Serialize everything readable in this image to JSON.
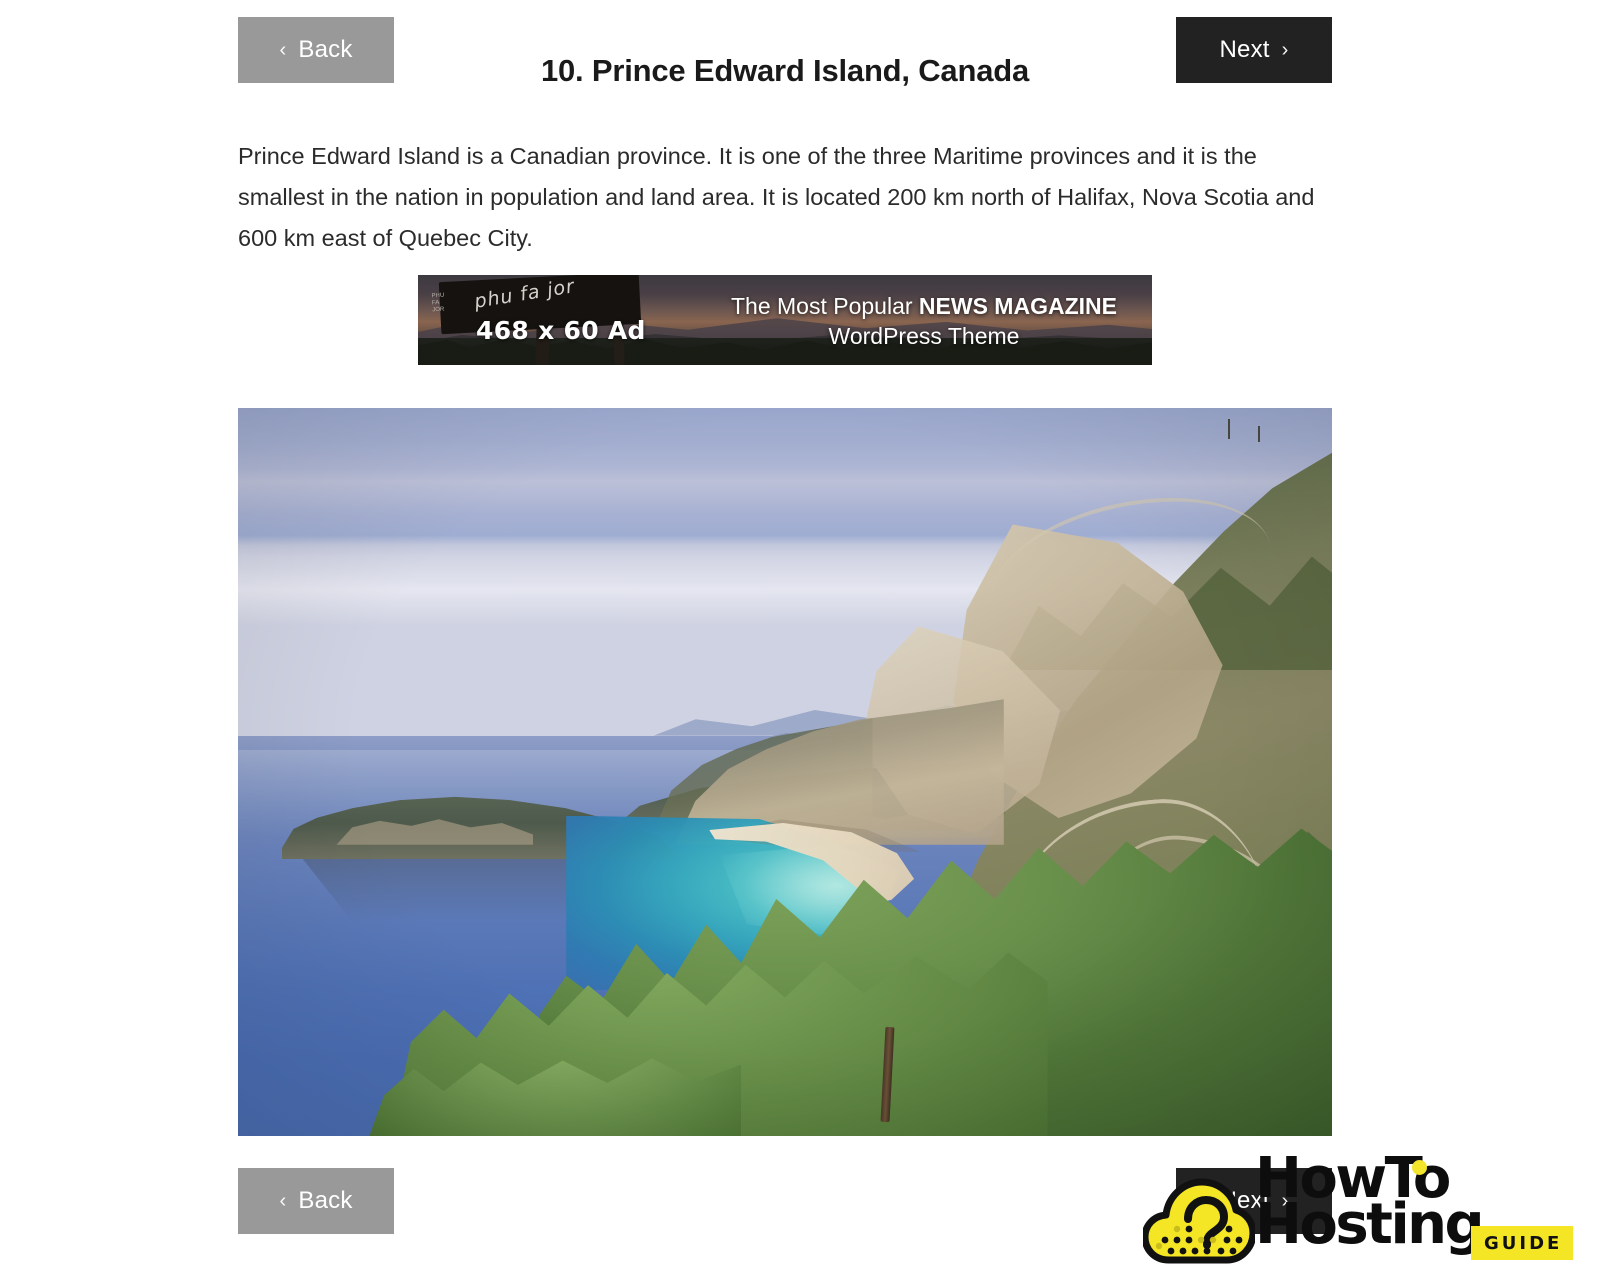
{
  "nav": {
    "back_label": "Back",
    "next_label": "Next",
    "back_icon": "chevron-left-icon",
    "next_icon": "chevron-right-icon",
    "back_color": "#999999",
    "next_color": "#222222"
  },
  "header": {
    "title": "10. Prince Edward Island, Canada"
  },
  "article": {
    "body": "Prince Edward Island is a Canadian province. It is one of the three Maritime provinces and it is the smallest in the nation in population and land area. It is located 200 km north of Halifax, Nova Scotia and 600 km east of Quebec City."
  },
  "ad": {
    "size_label": "468 x 60 Ad",
    "sign_text": "phu fa jor",
    "sign_small": "PHU\nFA\nJOR",
    "headline_regular": "The Most Popular ",
    "headline_bold": "NEWS MAGAZINE",
    "subline": "WordPress Theme"
  },
  "photo": {
    "alt": "Coastal bay with turquoise water, white sand beach and limestone cliffs",
    "sea_color": "#4f71b5",
    "bay_color": "#47bfc4",
    "sand_color": "#e4d6bc",
    "foliage_color": "#6a914c"
  },
  "logo": {
    "line1": "HowTo",
    "line2": "Hosting",
    "badge": "GUIDE",
    "icon": "cloud-question-icon",
    "accent_color": "#f4e625"
  }
}
